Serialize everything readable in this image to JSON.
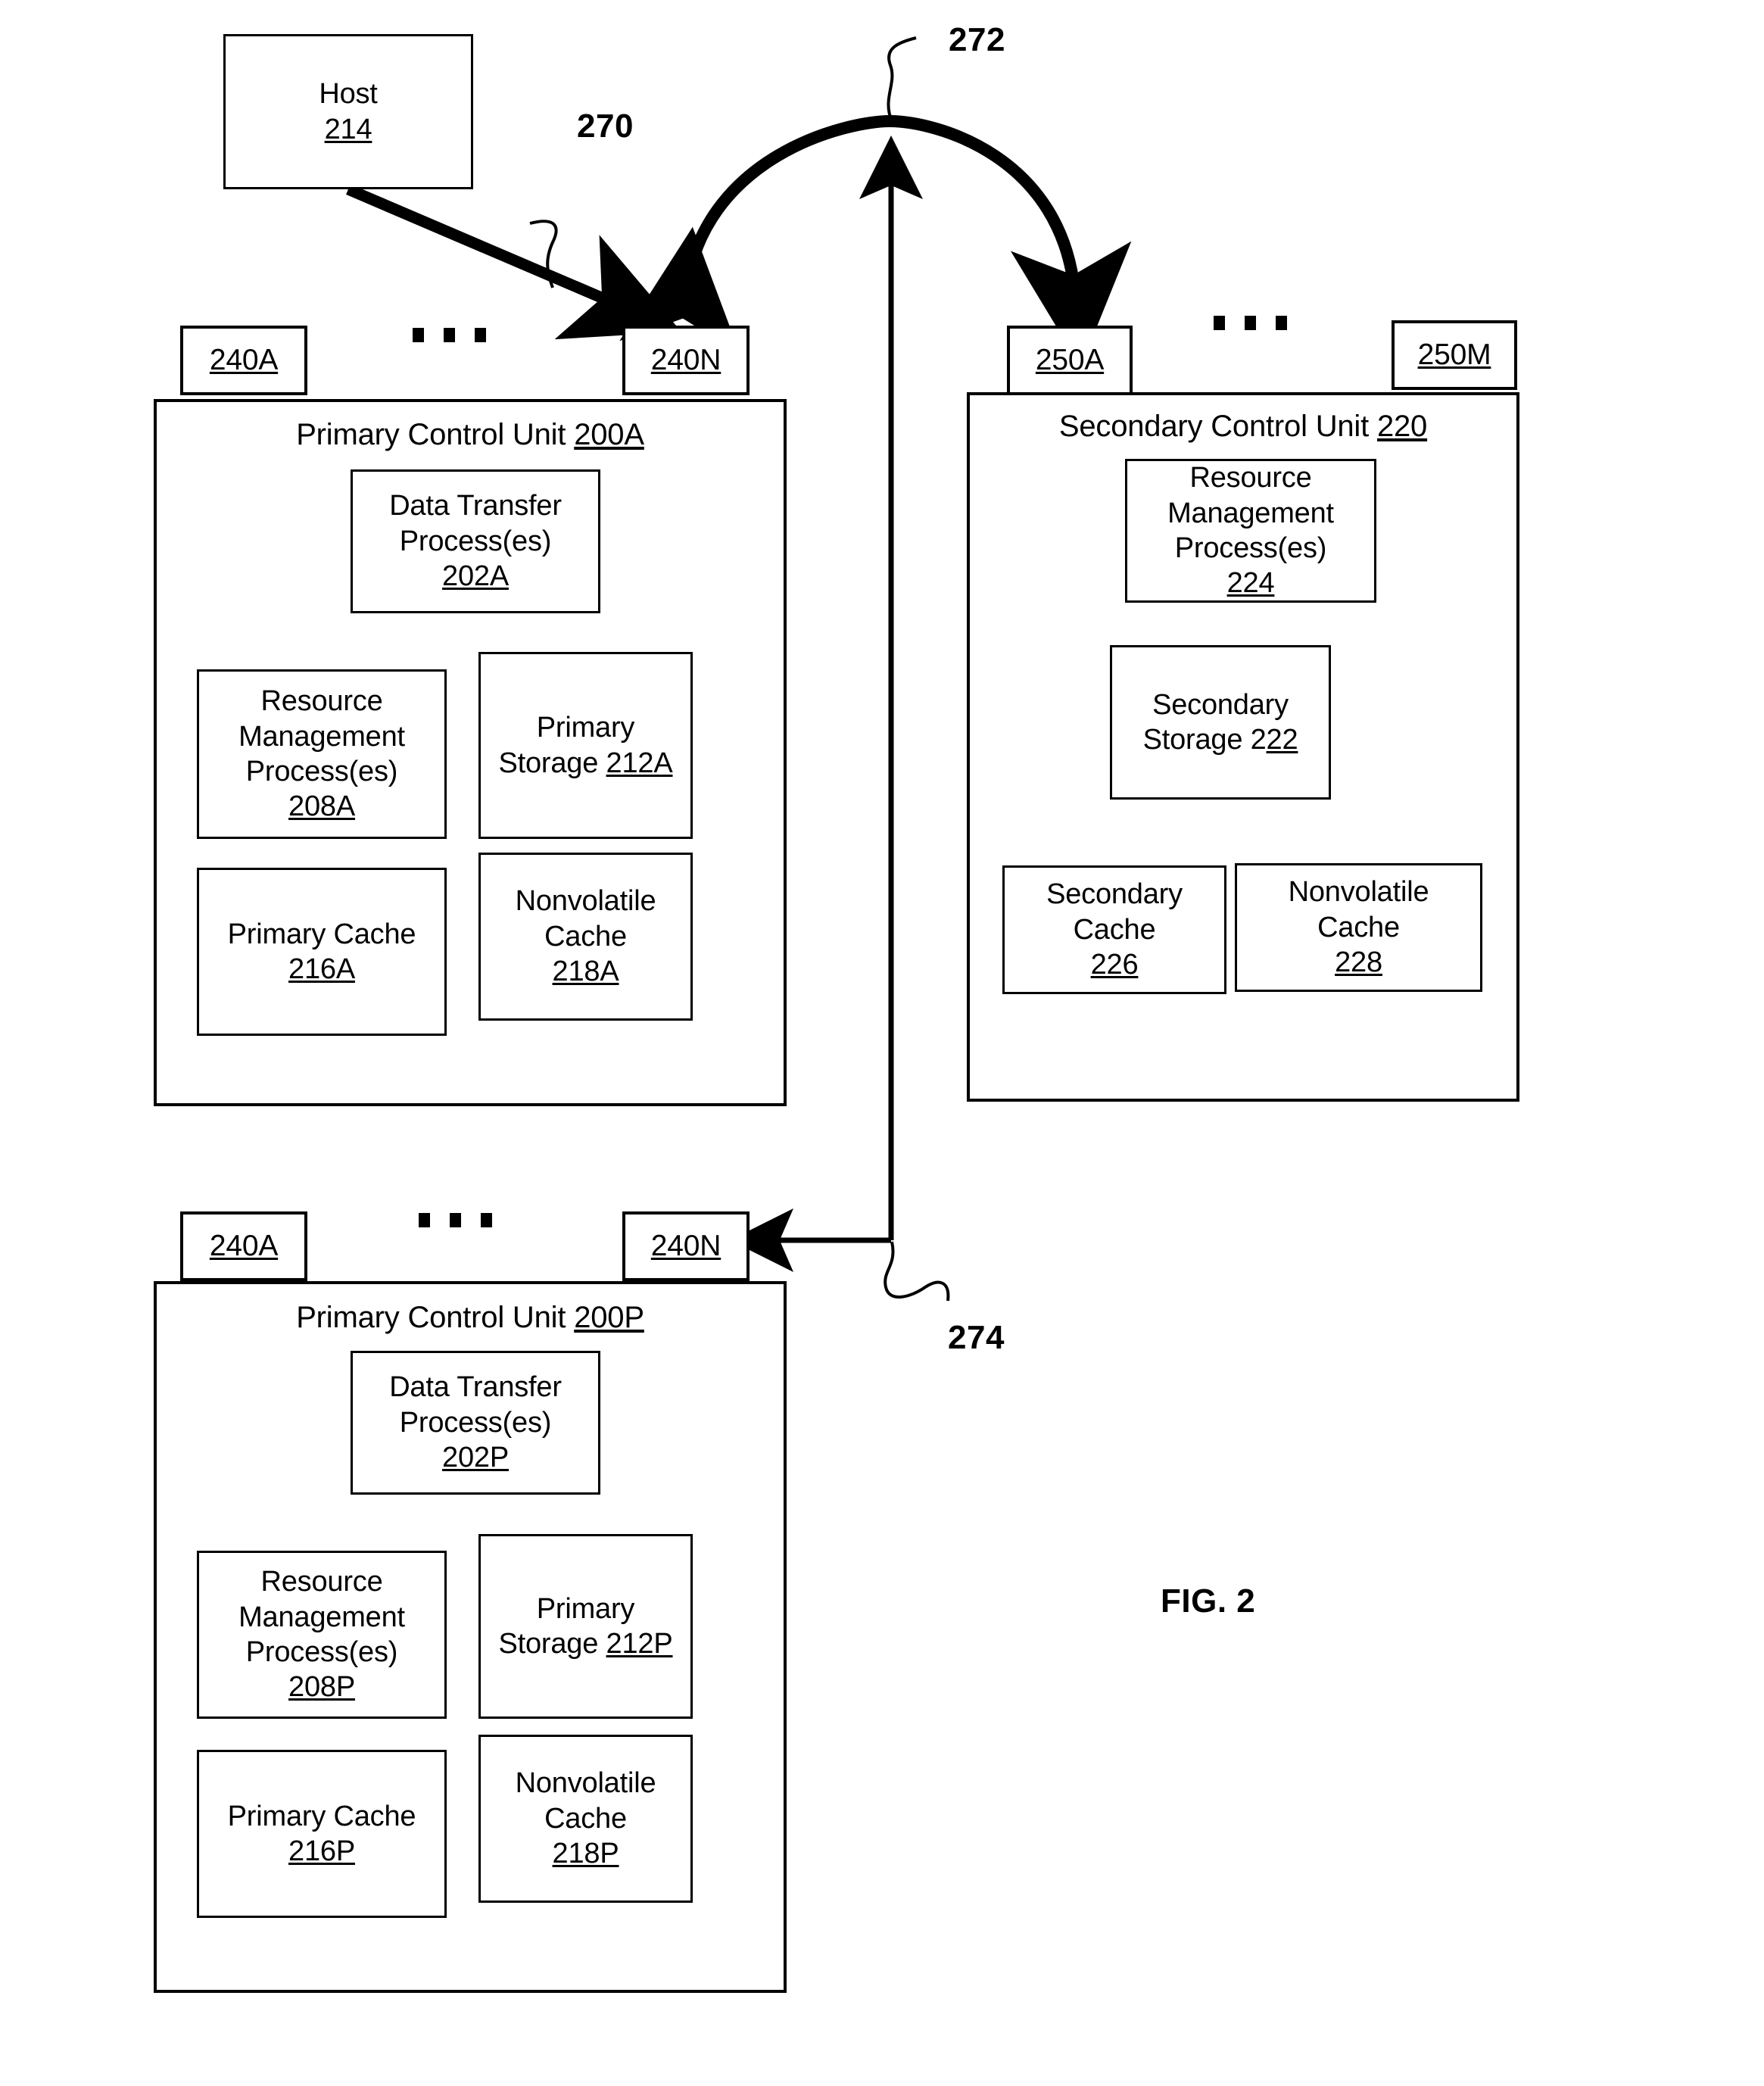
{
  "figure": {
    "label": "FIG. 2"
  },
  "host": {
    "name": "Host",
    "ref": "214"
  },
  "callouts": {
    "host_link": "270",
    "interconnect_apex": "272",
    "lower_link": "274"
  },
  "ellipsis": "• • •",
  "primary_unit_a": {
    "title_text": "Primary Control Unit ",
    "title_ref": "200A",
    "ports": {
      "first": "240A",
      "last": "240N"
    },
    "boxes": [
      {
        "line1": "Data Transfer",
        "line2": "Process(es)",
        "ref": "202A"
      },
      {
        "line1": "Resource",
        "line2": "Management",
        "line3": "Process(es)",
        "ref": "208A"
      },
      {
        "line1": "Primary",
        "line2": "Storage ",
        "ref": "212A"
      },
      {
        "line1": "Primary Cache",
        "ref": "216A"
      },
      {
        "line1": "Nonvolatile",
        "line2": "Cache",
        "ref": "218A"
      }
    ]
  },
  "secondary_unit": {
    "title_text": "Secondary Control Unit ",
    "title_ref": "220",
    "ports": {
      "first": "250A",
      "last": "250M"
    },
    "boxes": [
      {
        "line1": "Resource",
        "line2": "Management",
        "line3": "Process(es)",
        "ref": "224"
      },
      {
        "line1": "Secondary",
        "line2": "Storage 2",
        "ref": "22"
      },
      {
        "line1": "Secondary",
        "line2": "Cache",
        "ref": "226"
      },
      {
        "line1": "Nonvolatile",
        "line2": "Cache",
        "ref": "228"
      }
    ],
    "secondary_storage_full": "Secondary Storage 222"
  },
  "primary_unit_p": {
    "title_text": "Primary Control Unit ",
    "title_ref": "200P",
    "ports": {
      "first": "240A",
      "last": "240N"
    },
    "boxes": [
      {
        "line1": "Data Transfer",
        "line2": "Process(es)",
        "ref": "202P"
      },
      {
        "line1": "Resource",
        "line2": "Management",
        "line3": "Process(es)",
        "ref": "208P"
      },
      {
        "line1": "Primary",
        "line2": "Storage ",
        "ref": "212P"
      },
      {
        "line1": "Primary Cache",
        "ref": "216P"
      },
      {
        "line1": "Nonvolatile",
        "line2": "Cache",
        "ref": "218P"
      }
    ]
  }
}
